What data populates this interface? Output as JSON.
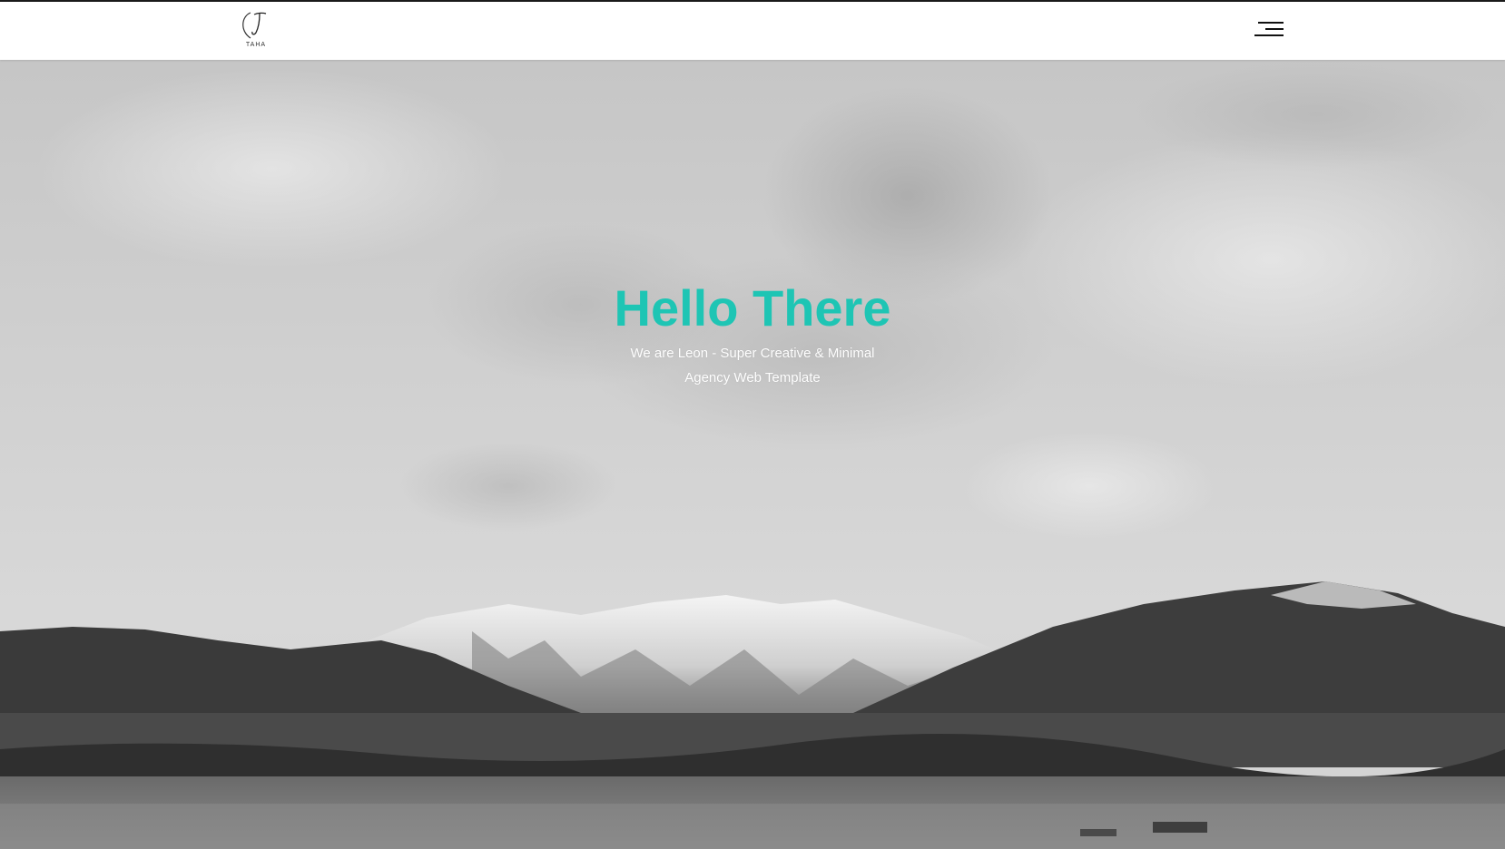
{
  "brand": {
    "logo_monogram": "J",
    "logo_text": "TAHA"
  },
  "nav": {
    "menu_icon": "hamburger-menu-icon"
  },
  "hero": {
    "title": "Hello There",
    "subtitle_line1": "We are Leon - Super Creative & Minimal",
    "subtitle_line2": "Agency Web Template",
    "background": "grayscale snowy mountain landscape under cloudy sky"
  },
  "colors": {
    "accent": "#1ec5b4",
    "nav_bg": "#ffffff",
    "hero_text": "#ffffff"
  }
}
